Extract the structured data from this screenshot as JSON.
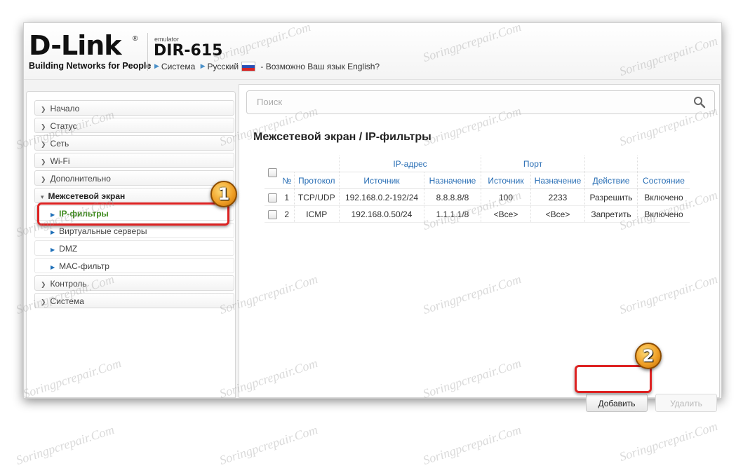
{
  "header": {
    "logo": "D-Link",
    "logo_reg": "®",
    "logo_tagline": "Building Networks for People",
    "emulator_label": "emulator",
    "model": "DIR-615",
    "nav_system": "Система",
    "nav_language": "Русский",
    "nav_language_hint": "- Возможно Ваш язык English?"
  },
  "sidebar": {
    "items": [
      {
        "label": "Начало"
      },
      {
        "label": "Статус"
      },
      {
        "label": "Сеть"
      },
      {
        "label": "Wi-Fi"
      },
      {
        "label": "Дополнительно"
      },
      {
        "label": "Межсетевой экран"
      },
      {
        "label": "IP-фильтры"
      },
      {
        "label": "Виртуальные серверы"
      },
      {
        "label": "DMZ"
      },
      {
        "label": "MAC-фильтр"
      },
      {
        "label": "Контроль"
      },
      {
        "label": "Система"
      }
    ]
  },
  "search": {
    "placeholder": "Поиск"
  },
  "page": {
    "title": "Межсетевой экран /  IP-фильтры"
  },
  "table": {
    "group_ip": "IP-адрес",
    "group_port": "Порт",
    "columns": [
      "№",
      "Протокол",
      "Источник",
      "Назначение",
      "Источник",
      "Назначение",
      "Действие",
      "Состояние"
    ],
    "rows": [
      [
        "1",
        "TCP/UDP",
        "192.168.0.2-192/24",
        "8.8.8.8/8",
        "100",
        "2233",
        "Разрешить",
        "Включено"
      ],
      [
        "2",
        "ICMP",
        "192.168.0.50/24",
        "1.1.1.1/8",
        "<Все>",
        "<Все>",
        "Запретить",
        "Включено"
      ]
    ]
  },
  "buttons": {
    "add": "Добавить",
    "delete": "Удалить"
  },
  "annotations": {
    "badge1": "1",
    "badge2": "2"
  },
  "watermark": "Soringpcrepair.Com"
}
